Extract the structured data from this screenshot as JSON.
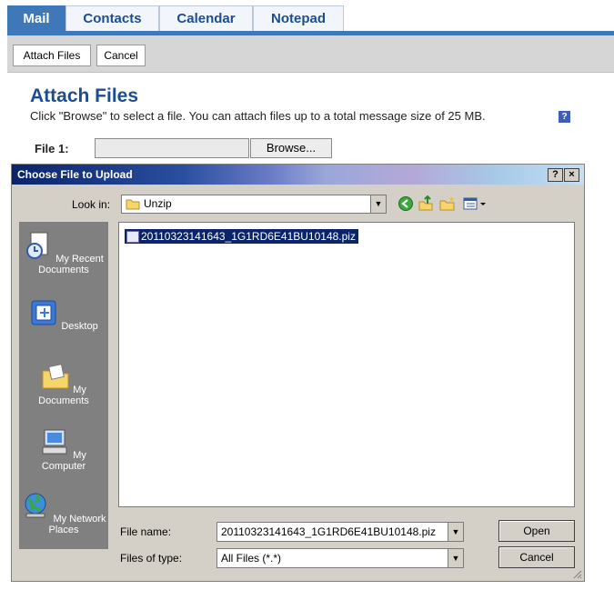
{
  "tabs": [
    {
      "label": "Mail",
      "active": true
    },
    {
      "label": "Contacts",
      "active": false
    },
    {
      "label": "Calendar",
      "active": false
    },
    {
      "label": "Notepad",
      "active": false
    }
  ],
  "toolbar": {
    "attach_label": "Attach Files",
    "cancel_label": "Cancel"
  },
  "page": {
    "title": "Attach Files",
    "description": "Click \"Browse\" to select a file. You can attach files up to a total message size of 25 MB.",
    "help_icon": "?",
    "file1_label": "File 1:",
    "browse_label": "Browse..."
  },
  "dialog": {
    "title": "Choose File to Upload",
    "help_btn": "?",
    "close_btn": "×",
    "look_in_label": "Look in:",
    "look_in_value": "Unzip",
    "places": [
      {
        "label": "My Recent Documents",
        "icon": "recent-documents-icon"
      },
      {
        "label": "Desktop",
        "icon": "desktop-icon"
      },
      {
        "label": "My Documents",
        "icon": "my-documents-icon"
      },
      {
        "label": "My Computer",
        "icon": "my-computer-icon"
      },
      {
        "label": "My Network Places",
        "icon": "network-places-icon"
      }
    ],
    "files": [
      {
        "name": "20110323141643_1G1RD6E41BU10148.piz",
        "selected": true
      }
    ],
    "file_name_label": "File name:",
    "file_name_value": "20110323141643_1G1RD6E41BU10148.piz",
    "file_type_label": "Files of type:",
    "file_type_value": "All Files (*.*)",
    "open_label": "Open",
    "cancel_label": "Cancel"
  },
  "colors": {
    "accent": "#3e78b8",
    "title_blue": "#1c4e8f",
    "selection": "#0a246a"
  }
}
